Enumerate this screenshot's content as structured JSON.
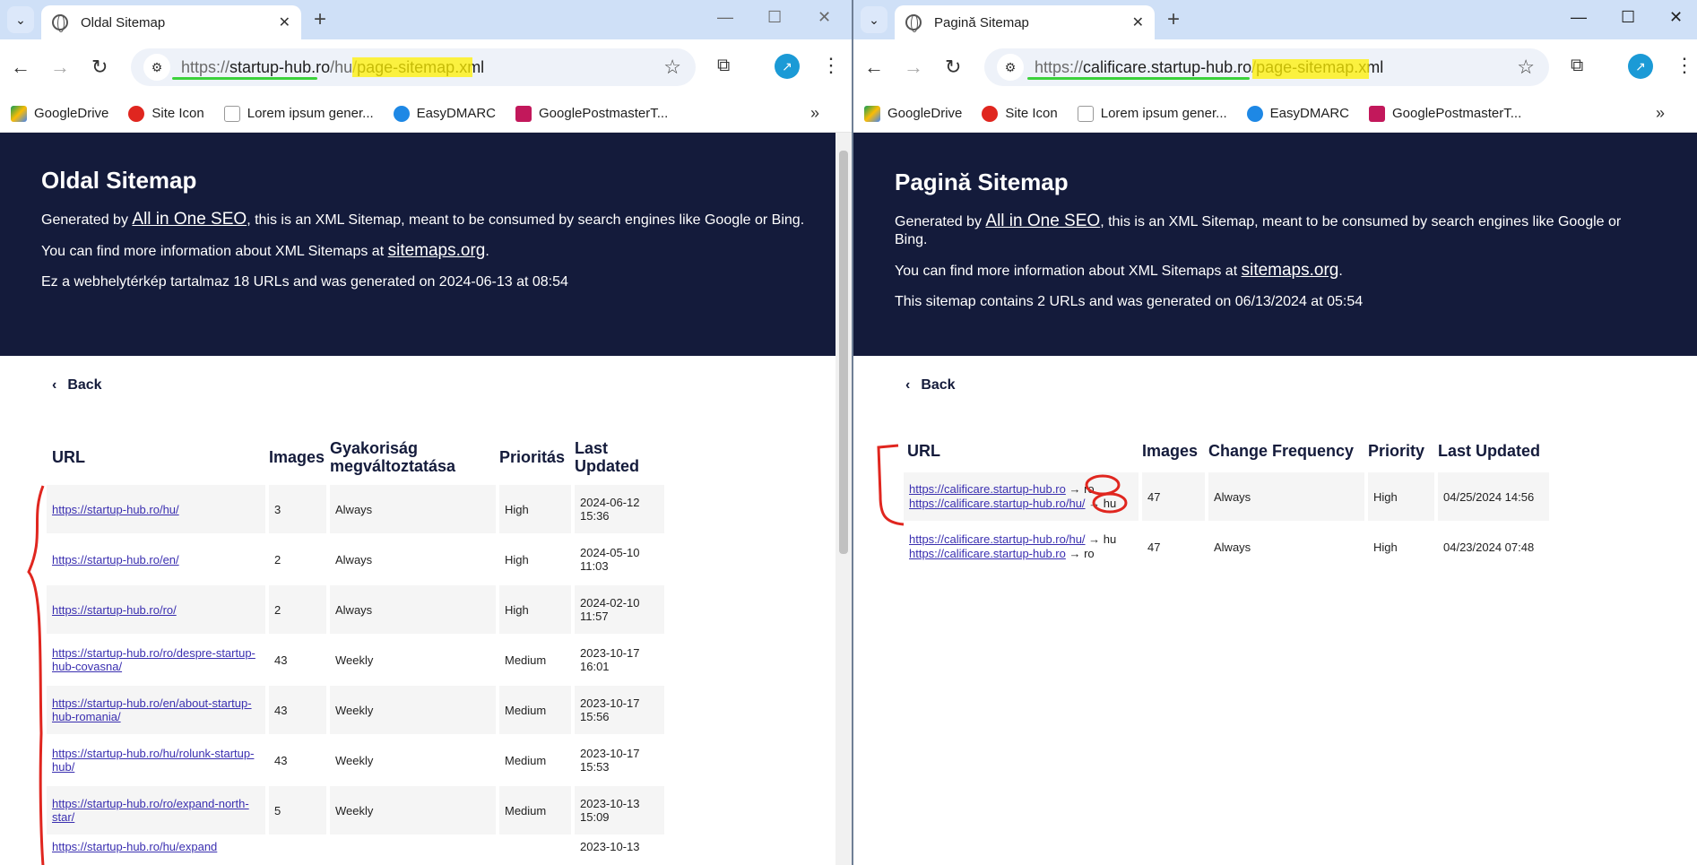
{
  "left": {
    "tab_title": "Oldal Sitemap",
    "url_scheme": "https://",
    "url_host": "startup-hub.ro",
    "url_path_a": "/hu/",
    "url_path_b": "page-sitemap.xml",
    "page_title": "Oldal Sitemap",
    "intro_prefix": "Generated by ",
    "intro_link": "All in One SEO",
    "intro_suffix": ", this is an XML Sitemap, meant to be consumed by search engines like Google or Bing.",
    "more_prefix": "You can find more information about XML Sitemaps at ",
    "more_link": "sitemaps.org",
    "more_suffix": ".",
    "summary": "Ez a webhelytérkép tartalmaz 18 URLs and was generated on 2024-06-13 at 08:54",
    "back": "Back",
    "headers": {
      "url": "URL",
      "images": "Images",
      "freq": "Gyakoriság megváltoztatása",
      "priority": "Prioritás",
      "updated": "Last Updated"
    },
    "rows": [
      {
        "url": "https://startup-hub.ro/hu/",
        "images": "3",
        "freq": "Always",
        "priority": "High",
        "updated": "2024-06-12 15:36"
      },
      {
        "url": "https://startup-hub.ro/en/",
        "images": "2",
        "freq": "Always",
        "priority": "High",
        "updated": "2024-05-10 11:03"
      },
      {
        "url": "https://startup-hub.ro/ro/",
        "images": "2",
        "freq": "Always",
        "priority": "High",
        "updated": "2024-02-10 11:57"
      },
      {
        "url": "https://startup-hub.ro/ro/despre-startup-hub-covasna/",
        "images": "43",
        "freq": "Weekly",
        "priority": "Medium",
        "updated": "2023-10-17 16:01"
      },
      {
        "url": "https://startup-hub.ro/en/about-startup-hub-romania/",
        "images": "43",
        "freq": "Weekly",
        "priority": "Medium",
        "updated": "2023-10-17 15:56"
      },
      {
        "url": "https://startup-hub.ro/hu/rolunk-startup-hub/",
        "images": "43",
        "freq": "Weekly",
        "priority": "Medium",
        "updated": "2023-10-17 15:53"
      },
      {
        "url": "https://startup-hub.ro/ro/expand-north-star/",
        "images": "5",
        "freq": "Weekly",
        "priority": "Medium",
        "updated": "2023-10-13 15:09"
      },
      {
        "url": "https://startup-hub.ro/hu/expand",
        "images": "",
        "freq": "",
        "priority": "",
        "updated": "2023-10-13"
      }
    ]
  },
  "right": {
    "tab_title": "Pagină Sitemap",
    "url_scheme": "https://",
    "url_host": "calificare.startup-hub.ro",
    "url_path_a": "/",
    "url_path_b": "page-sitemap.xml",
    "page_title": "Pagină Sitemap",
    "intro_prefix": "Generated by ",
    "intro_link": "All in One SEO",
    "intro_suffix": ", this is an XML Sitemap, meant to be consumed by search engines like Google or Bing.",
    "more_prefix": "You can find more information about XML Sitemaps at ",
    "more_link": "sitemaps.org",
    "more_suffix": ".",
    "summary": "This sitemap contains 2 URLs and was generated on 06/13/2024 at 05:54",
    "back": "Back",
    "headers": {
      "url": "URL",
      "images": "Images",
      "freq": "Change Frequency",
      "priority": "Priority",
      "updated": "Last Updated"
    },
    "rows": [
      {
        "url1": "https://calificare.startup-hub.ro",
        "lang1": "→ ro",
        "url2": "https://calificare.startup-hub.ro/hu/",
        "lang2": "→ hu",
        "images": "47",
        "freq": "Always",
        "priority": "High",
        "updated": "04/25/2024 14:56"
      },
      {
        "url1": "https://calificare.startup-hub.ro/hu/",
        "lang1": "→ hu",
        "url2": "https://calificare.startup-hub.ro",
        "lang2": "→ ro",
        "images": "47",
        "freq": "Always",
        "priority": "High",
        "updated": "04/23/2024 07:48"
      }
    ]
  },
  "bookmarks": [
    "GoogleDrive",
    "Site Icon",
    "Lorem ipsum gener...",
    "EasyDMARC",
    "GooglePostmasterT..."
  ],
  "colors": {
    "hero_bg": "#141b3b",
    "tabbar": "#cfe0f7",
    "annot_red": "#e0261f",
    "annot_green": "#3cd23c",
    "annot_yellow": "#fff000"
  }
}
